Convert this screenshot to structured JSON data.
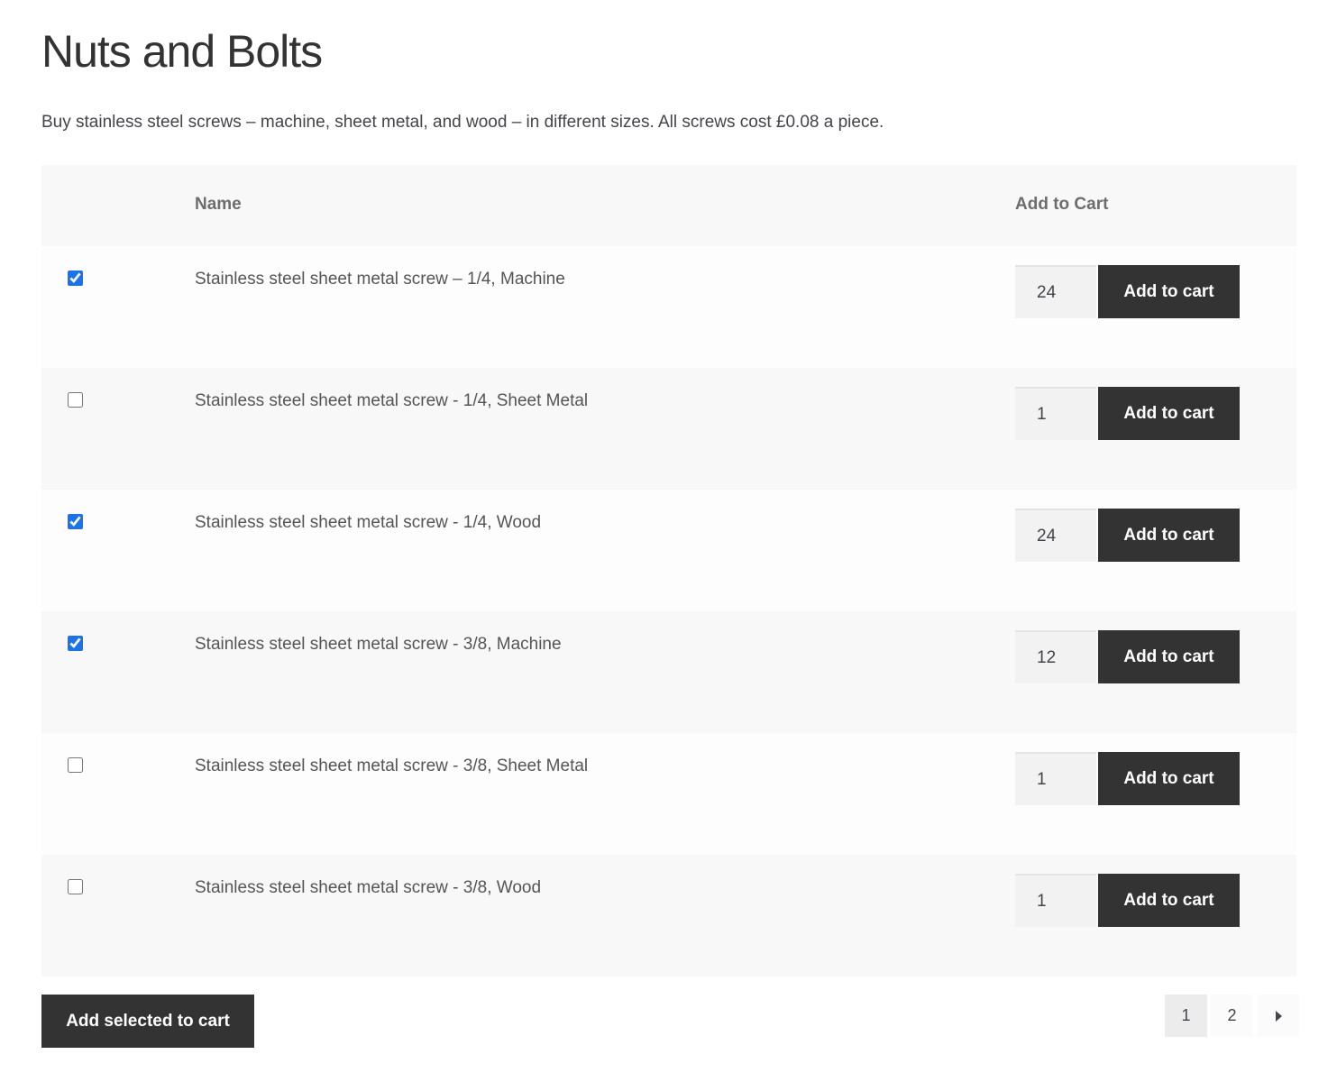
{
  "page": {
    "title": "Nuts and Bolts",
    "description": "Buy stainless steel screws – machine, sheet metal, and wood – in different sizes. All screws cost £0.08 a piece."
  },
  "table": {
    "headers": {
      "select": "",
      "name": "Name",
      "add_to_cart": "Add to Cart"
    },
    "rows": [
      {
        "checked": true,
        "name": "Stainless steel sheet metal screw – 1/4, Machine",
        "qty": "24",
        "button": "Add to cart"
      },
      {
        "checked": false,
        "name": "Stainless steel sheet metal screw - 1/4, Sheet Metal",
        "qty": "1",
        "button": "Add to cart"
      },
      {
        "checked": true,
        "name": "Stainless steel sheet metal screw - 1/4, Wood",
        "qty": "24",
        "button": "Add to cart"
      },
      {
        "checked": true,
        "name": "Stainless steel sheet metal screw - 3/8, Machine",
        "qty": "12",
        "button": "Add to cart"
      },
      {
        "checked": false,
        "name": "Stainless steel sheet metal screw - 3/8, Sheet Metal",
        "qty": "1",
        "button": "Add to cart"
      },
      {
        "checked": false,
        "name": "Stainless steel sheet metal screw - 3/8, Wood",
        "qty": "1",
        "button": "Add to cart"
      }
    ]
  },
  "footer": {
    "add_selected_label": "Add selected to cart",
    "pagination": {
      "pages": [
        "1",
        "2"
      ],
      "current": "1",
      "next_icon": "caret-right-icon"
    }
  },
  "colors": {
    "button_bg": "#333333",
    "checkbox_accent": "#1a73e8",
    "row_alt_bg": "#f8f8f8"
  }
}
